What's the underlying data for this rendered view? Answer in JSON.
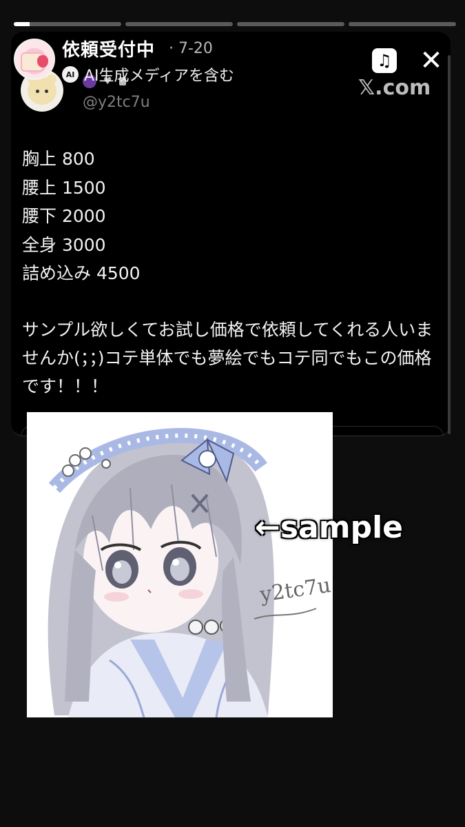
{
  "story": {
    "segments": [
      {
        "fill": 0.15
      },
      {
        "fill": 0.0
      },
      {
        "fill": 0.0
      },
      {
        "fill": 0.0
      }
    ],
    "title": "依頼受付中",
    "date": "· 7-20",
    "ai_badge": "AI",
    "ai_label": "AI生成メディアを含む"
  },
  "tweet": {
    "handle": "@y2tc7u",
    "source": "𝕏.com",
    "prices": [
      "胸上 800",
      "腰上 1500",
      "腰下 2000",
      "全身 3000",
      "詰め込み 4500"
    ],
    "message": "サンプル欲しくてお試し価格で依頼してくれる人いませんか(；；)コテ単体でも夢絵でもコテ同でもこの価格です！！！"
  },
  "image": {
    "annotation": "←sample",
    "signature": "y2tc7u"
  },
  "controls": {
    "music_icon": "music-note-icon",
    "close_icon": "close-icon",
    "close_glyph": "✕",
    "music_glyph": "♫"
  },
  "colors": {
    "background": "#0d0d0d",
    "card": "#000000",
    "hair": "#b9b9c6",
    "ribbon": "#a9b9e6"
  }
}
